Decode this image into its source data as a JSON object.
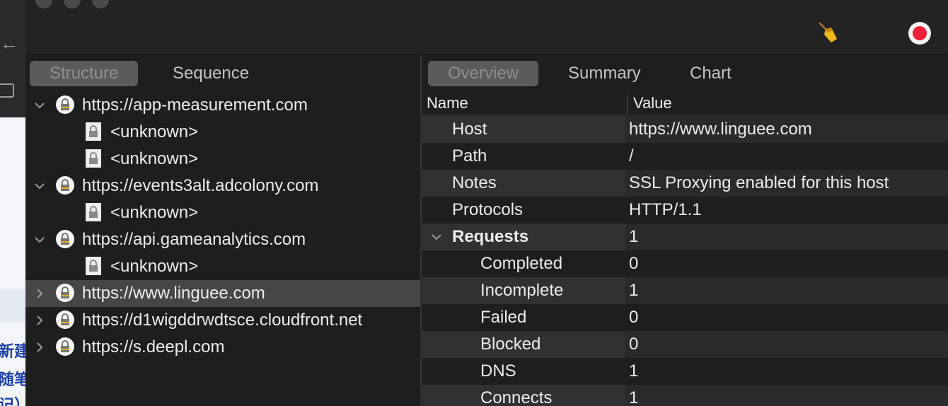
{
  "background_window": {
    "cjk_lines": [
      "新建",
      "随笔",
      "记）"
    ]
  },
  "left_pane": {
    "tabs": [
      "Structure",
      "Sequence"
    ],
    "tree": [
      {
        "label": "https://app-measurement.com",
        "kind": "host",
        "expanded": true
      },
      {
        "label": "<unknown>",
        "kind": "child"
      },
      {
        "label": "<unknown>",
        "kind": "child"
      },
      {
        "label": "https://events3alt.adcolony.com",
        "kind": "host",
        "expanded": true
      },
      {
        "label": "<unknown>",
        "kind": "child"
      },
      {
        "label": "https://api.gameanalytics.com",
        "kind": "host",
        "expanded": true
      },
      {
        "label": "<unknown>",
        "kind": "child"
      },
      {
        "label": "https://www.linguee.com",
        "kind": "host",
        "expanded": false,
        "selected": true
      },
      {
        "label": "https://d1wigddrwdtsce.cloudfront.net",
        "kind": "host",
        "expanded": false
      },
      {
        "label": "https://s.deepl.com",
        "kind": "host",
        "expanded": false
      }
    ]
  },
  "right_pane": {
    "tabs": [
      "Overview",
      "Summary",
      "Chart"
    ],
    "columns": {
      "name": "Name",
      "value": "Value"
    },
    "rows": [
      {
        "name": "Host",
        "value": "https://www.linguee.com",
        "level": 0
      },
      {
        "name": "Path",
        "value": "/",
        "level": 0
      },
      {
        "name": "Notes",
        "value": "SSL Proxying enabled for this host",
        "level": 0
      },
      {
        "name": "Protocols",
        "value": "HTTP/1.1",
        "level": 0
      },
      {
        "name": "Requests",
        "value": "1",
        "level": 0,
        "group": true
      },
      {
        "name": "Completed",
        "value": "0",
        "level": 1
      },
      {
        "name": "Incomplete",
        "value": "1",
        "level": 1
      },
      {
        "name": "Failed",
        "value": "0",
        "level": 1
      },
      {
        "name": "Blocked",
        "value": "0",
        "level": 1
      },
      {
        "name": "DNS",
        "value": "1",
        "level": 1
      },
      {
        "name": "Connects",
        "value": "1",
        "level": 1
      }
    ]
  },
  "toolbar": {
    "icons": [
      "broom-icon",
      "record-icon"
    ],
    "record_color": "#ee1f3a"
  }
}
